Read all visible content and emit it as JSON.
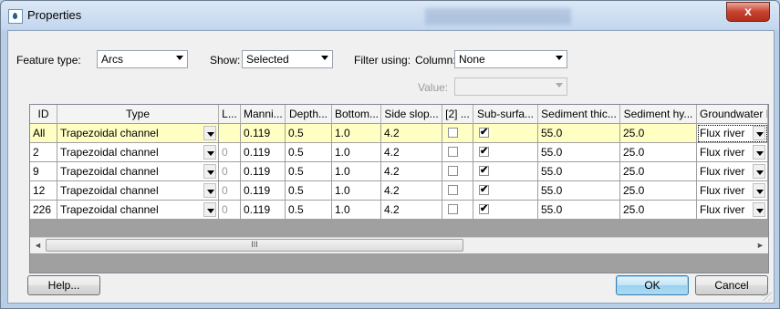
{
  "window": {
    "title": "Properties",
    "close_label": "x"
  },
  "filters": {
    "feature_type_label": "Feature type:",
    "feature_type_value": "Arcs",
    "show_label": "Show:",
    "show_value": "Selected",
    "filter_using_label": "Filter using:",
    "column_label": "Column:",
    "column_value": "None",
    "value_label": "Value:",
    "value_value": ""
  },
  "table": {
    "headers": [
      "ID",
      "Type",
      "L...",
      "Manni...",
      "Depth...",
      "Bottom...",
      "Side slop...",
      "[2] ...",
      "Sub-surfa...",
      "Sediment thic...",
      "Sediment hy...",
      "Groundwater BC"
    ],
    "rows": [
      {
        "id": "All",
        "type": "Trapezoidal channel",
        "l": "",
        "manning": "0.119",
        "depth": "0.5",
        "bottom": "1.0",
        "side": "4.2",
        "c2": false,
        "sub": true,
        "sed_thic": "55.0",
        "sed_hy": "25.0",
        "gw": "Flux river"
      },
      {
        "id": "2",
        "type": "Trapezoidal channel",
        "l": "0",
        "manning": "0.119",
        "depth": "0.5",
        "bottom": "1.0",
        "side": "4.2",
        "c2": false,
        "sub": true,
        "sed_thic": "55.0",
        "sed_hy": "25.0",
        "gw": "Flux river"
      },
      {
        "id": "9",
        "type": "Trapezoidal channel",
        "l": "0",
        "manning": "0.119",
        "depth": "0.5",
        "bottom": "1.0",
        "side": "4.2",
        "c2": false,
        "sub": true,
        "sed_thic": "55.0",
        "sed_hy": "25.0",
        "gw": "Flux river"
      },
      {
        "id": "12",
        "type": "Trapezoidal channel",
        "l": "0",
        "manning": "0.119",
        "depth": "0.5",
        "bottom": "1.0",
        "side": "4.2",
        "c2": false,
        "sub": true,
        "sed_thic": "55.0",
        "sed_hy": "25.0",
        "gw": "Flux river"
      },
      {
        "id": "226",
        "type": "Trapezoidal channel",
        "l": "0",
        "manning": "0.119",
        "depth": "0.5",
        "bottom": "1.0",
        "side": "4.2",
        "c2": false,
        "sub": true,
        "sed_thic": "55.0",
        "sed_hy": "25.0",
        "gw": "Flux river"
      }
    ],
    "scroll_grip": "III",
    "scroll_left": "◄",
    "scroll_right": "►"
  },
  "buttons": {
    "help": "Help...",
    "ok": "OK",
    "cancel": "Cancel"
  },
  "colors": {
    "highlight_row": "#ffffc4",
    "default_button": "#98d1ef"
  },
  "icons": {
    "title": "droplet-icon",
    "checked": "checkbox-checked-icon"
  },
  "checkmark": "✔"
}
